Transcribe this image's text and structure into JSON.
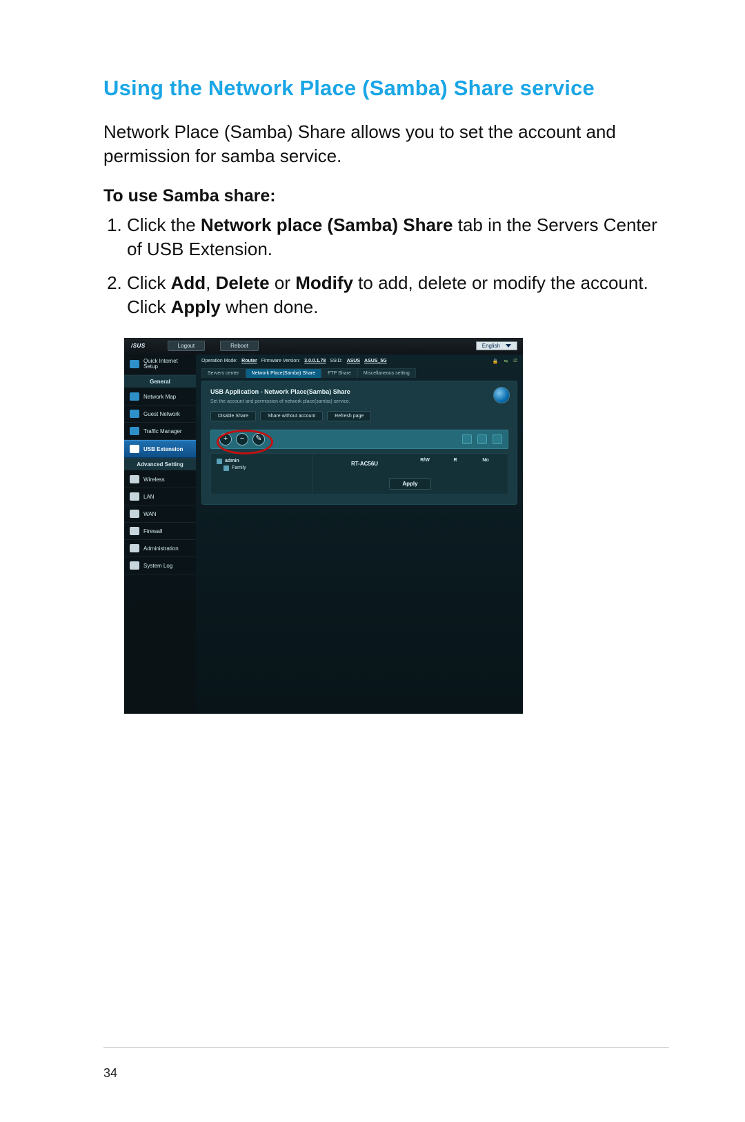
{
  "page_number": "34",
  "title": "Using the Network Place (Samba) Share service",
  "intro": "Network Place (Samba) Share allows you to set the account and permission for samba service.",
  "sub_head": "To use Samba share:",
  "steps": {
    "s1_pre": "Click the ",
    "s1_bold": "Network place (Samba) Share",
    "s1_post": " tab in the Servers Center of USB Extension.",
    "s2_a": "Click ",
    "s2_add": "Add",
    "s2_comma": ", ",
    "s2_del": "Delete",
    "s2_or": " or ",
    "s2_mod": "Modify",
    "s2_mid": " to add, delete or modify the account. Click ",
    "s2_apply": "Apply",
    "s2_end": " when done."
  },
  "shot": {
    "brand": "/SUS",
    "top_buttons": {
      "logout": "Logout",
      "reboot": "Reboot"
    },
    "language": "English",
    "info": {
      "op_mode_label": "Operation Mode: ",
      "op_mode_value": "Router",
      "fw_label": "Firmware Version: ",
      "fw_value": "3.0.0.1.78",
      "ssid_label": "SSID: ",
      "ssid1": "ASUS",
      "ssid2": "ASUS_5G"
    },
    "tabs": {
      "servers": "Servers center",
      "samba": "Network Place(Samba) Share",
      "ftp": "FTP Share",
      "misc": "Miscellaneous setting"
    },
    "panel": {
      "title": "USB Application - Network Place(Samba) Share",
      "subtitle": "Set the account and permission of network place(samba) service.",
      "disable": "Disable Share",
      "share_noacct": "Share without account",
      "refresh": "Refresh page"
    },
    "sidebar": {
      "quick": "Quick Internet Setup",
      "general": "General",
      "items_general": [
        "Network Map",
        "Guest Network",
        "Traffic Manager",
        "USB Extension"
      ],
      "advanced": "Advanced Setting",
      "items_adv": [
        "Wireless",
        "LAN",
        "WAN",
        "Firewall",
        "Administration",
        "System Log"
      ]
    },
    "tree": {
      "admin": "admin",
      "family": "Family"
    },
    "cols": {
      "device": "RT-AC56U",
      "rw": "R/W",
      "r": "R",
      "no": "No"
    },
    "apply": "Apply"
  }
}
